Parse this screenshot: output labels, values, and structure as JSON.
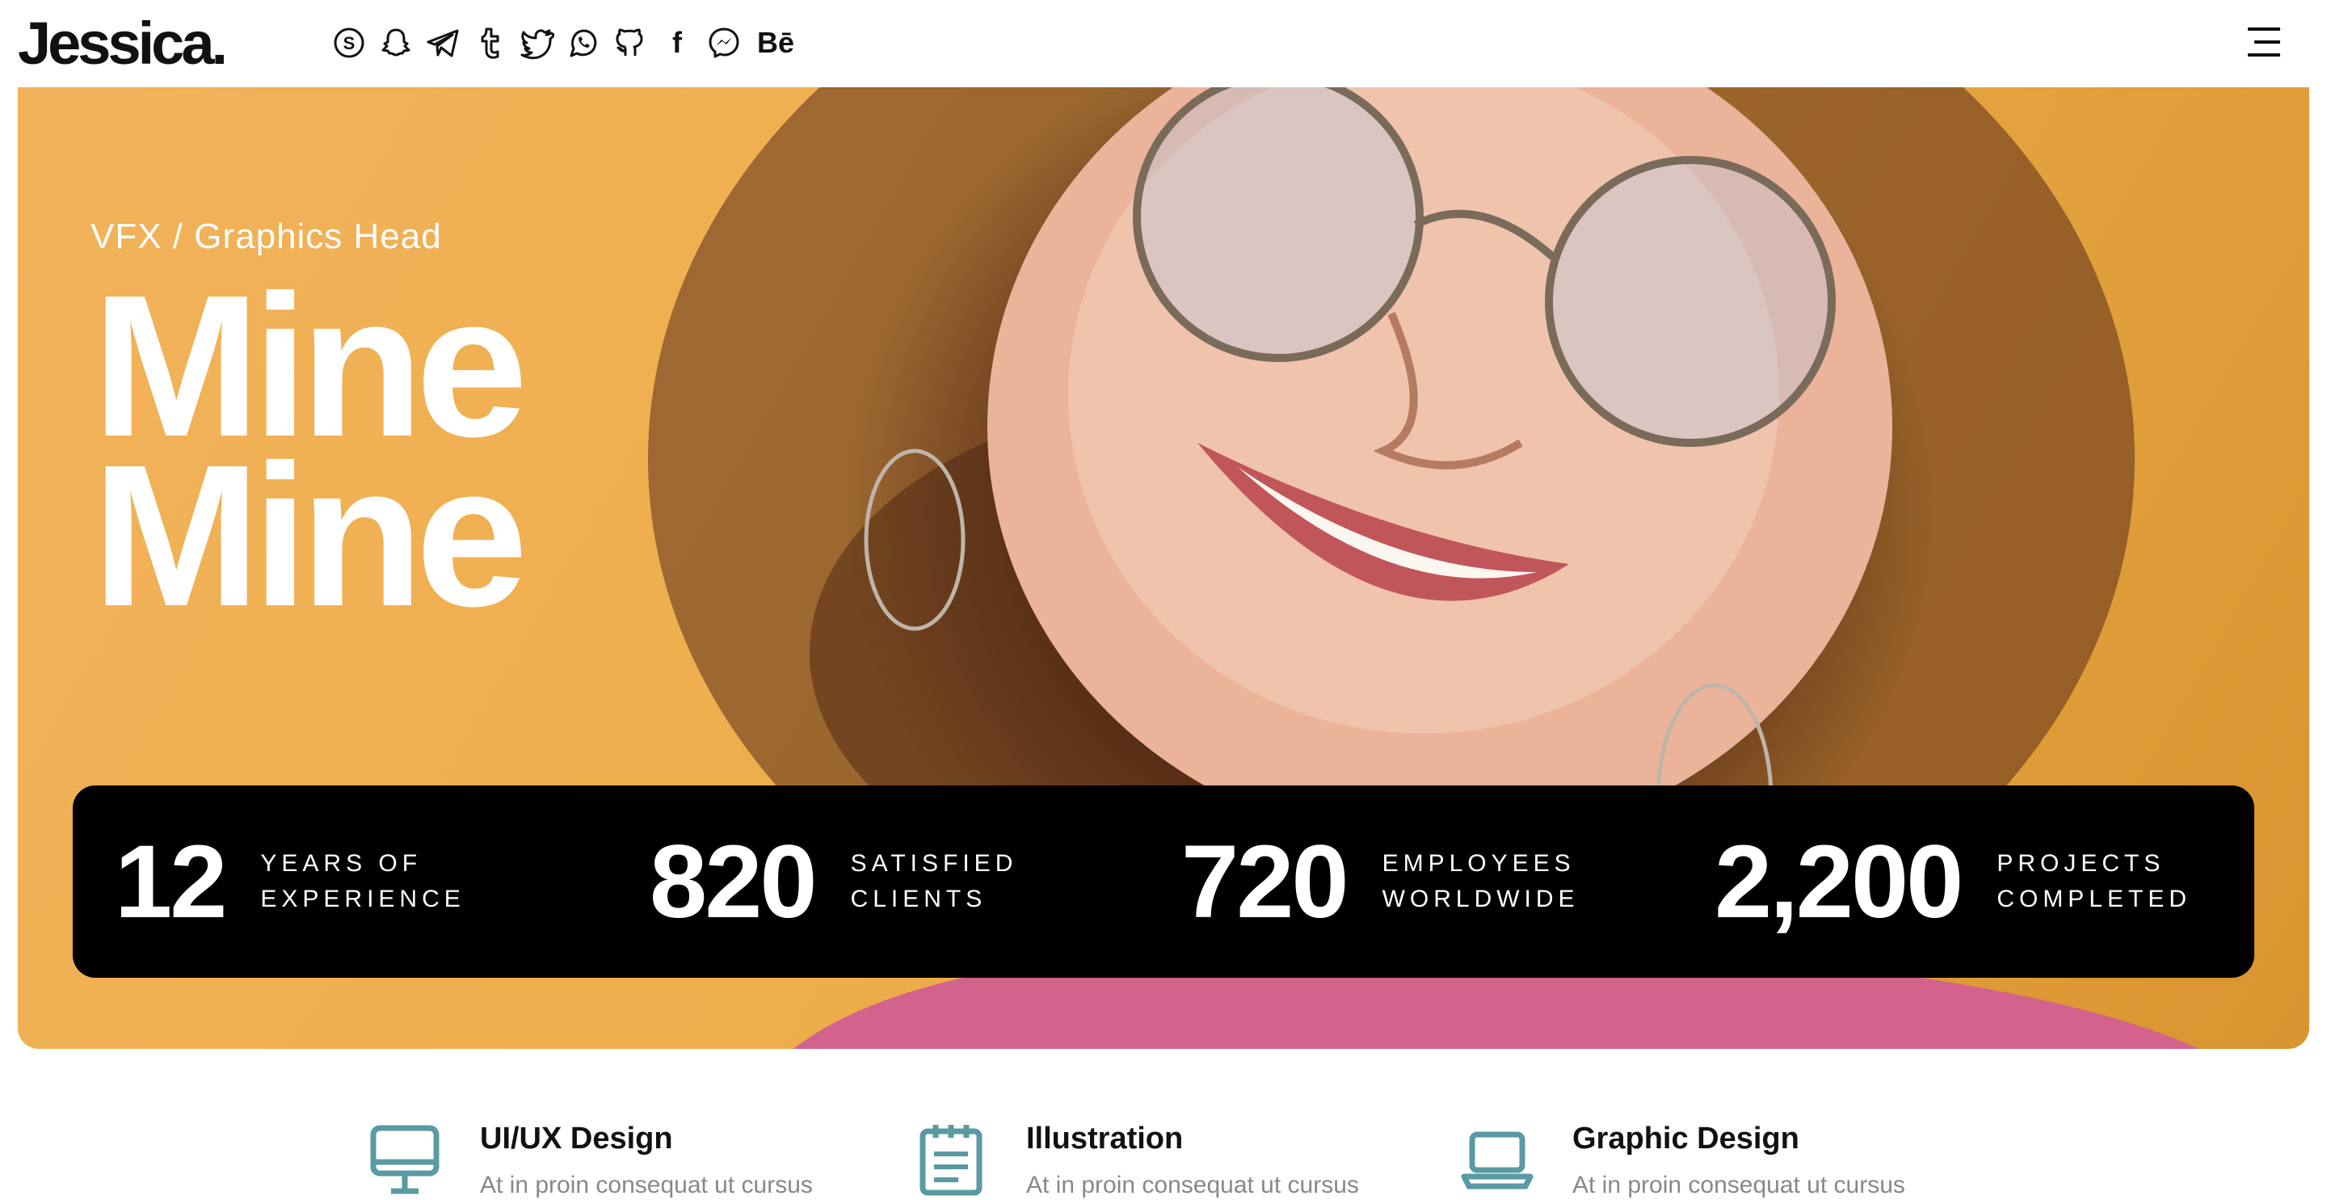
{
  "header": {
    "logo": "Jessica.",
    "socials": [
      {
        "icon": "skype-icon"
      },
      {
        "icon": "snapchat-icon"
      },
      {
        "icon": "telegram-icon"
      },
      {
        "icon": "tumblr-icon"
      },
      {
        "icon": "twitter-icon"
      },
      {
        "icon": "whatsapp-icon"
      },
      {
        "icon": "github-icon"
      },
      {
        "icon": "facebook-icon",
        "text": "f"
      },
      {
        "icon": "messenger-icon"
      },
      {
        "icon": "behance-icon",
        "text": "Bē"
      }
    ],
    "menu_icon": "hamburger-menu-icon"
  },
  "hero": {
    "subtitle": "VFX / Graphics Head",
    "title_line1": "Mine",
    "title_line2": "Mine"
  },
  "stats": [
    {
      "number": "12",
      "label_line1": "YEARS OF",
      "label_line2": "EXPERIENCE"
    },
    {
      "number": "820",
      "label_line1": "SATISFIED",
      "label_line2": "CLIENTS"
    },
    {
      "number": "720",
      "label_line1": "EMPLOYEES",
      "label_line2": "WORLDWIDE"
    },
    {
      "number": "2,200",
      "label_line1": "PROJECTS",
      "label_line2": "COMPLETED"
    }
  ],
  "services": [
    {
      "icon": "monitor-icon",
      "title": "UI/UX Design",
      "desc": "At in proin consequat ut cursus"
    },
    {
      "icon": "notepad-icon",
      "title": "Illustration",
      "desc": "At in proin consequat ut cursus"
    },
    {
      "icon": "laptop-icon",
      "title": "Graphic Design",
      "desc": "At in proin consequat ut cursus"
    }
  ],
  "colors": {
    "accent": "#5a9aa3",
    "hero_bg": "#eeae4c",
    "stats_bg": "#000000"
  }
}
